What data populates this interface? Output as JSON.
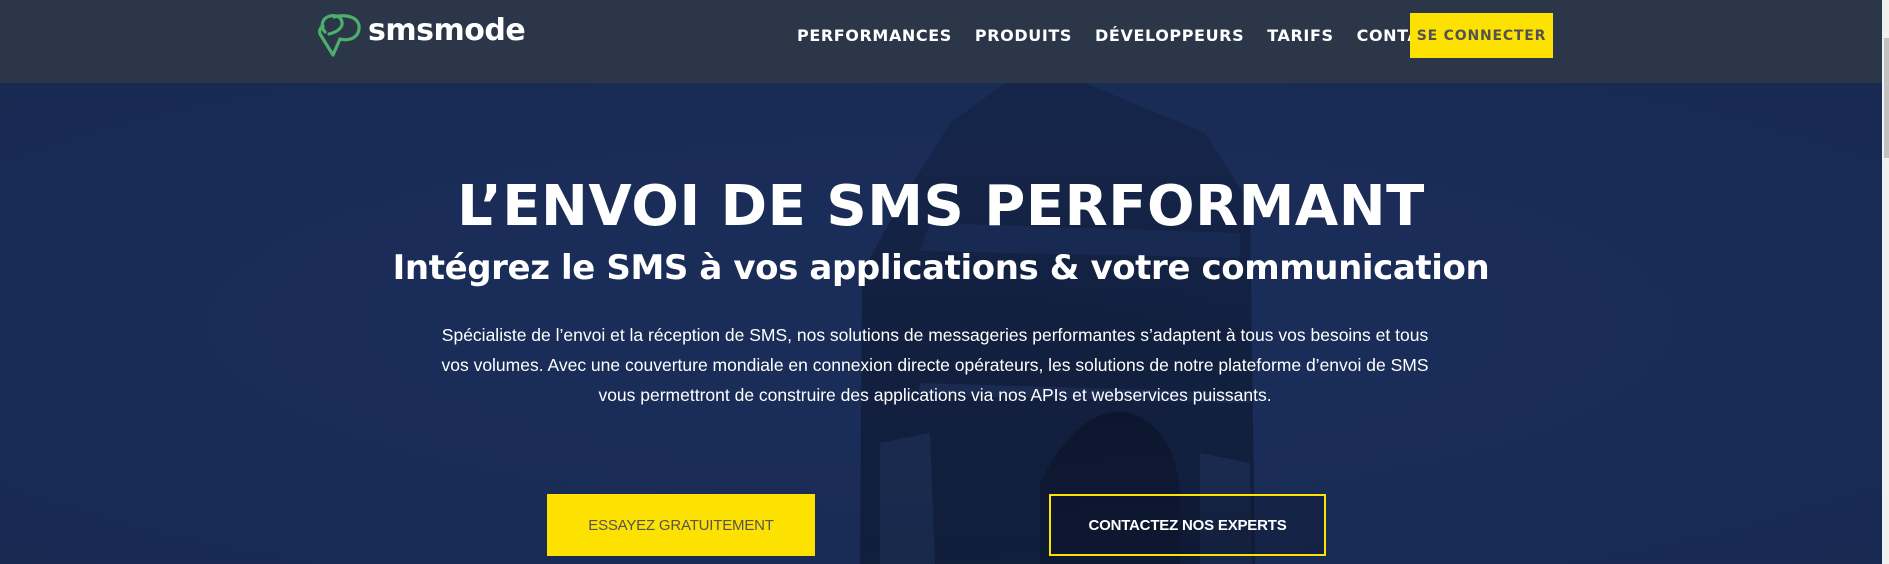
{
  "header": {
    "logo": {
      "text": "smsmode",
      "icon": "speech-bubble-logo-icon",
      "icon_color": "#4caf6a"
    },
    "nav": [
      {
        "label": "PERFORMANCES"
      },
      {
        "label": "PRODUITS"
      },
      {
        "label": "DÉVELOPPEURS"
      },
      {
        "label": "TARIFS"
      },
      {
        "label": "CONTACT"
      }
    ],
    "login_label": "SE CONNECTER",
    "background_color": "#2b3749"
  },
  "hero": {
    "headline": "L’ENVOI DE SMS PERFORMANT",
    "subtitle": "Intégrez le SMS à vos applications & votre communication",
    "intro": "Spécialiste de l’envoi et la réception de SMS, nos solutions de messageries performantes s’adaptent à tous vos besoins et tous vos volumes. Avec une couverture mondiale en connexion directe opérateurs, les solutions de notre plateforme d’envoi de SMS vous permettront de construire des applications via nos APIs et webservices puissants.",
    "background_image": "arc-de-triomphe-night-photo",
    "cta_primary": "ESSAYEZ GRATUITEMENT",
    "cta_secondary": "CONTACTEZ NOS EXPERTS"
  },
  "colors": {
    "accent_yellow": "#fde100",
    "hero_blue": "#1a2c57",
    "button_text_gray": "#545454"
  }
}
